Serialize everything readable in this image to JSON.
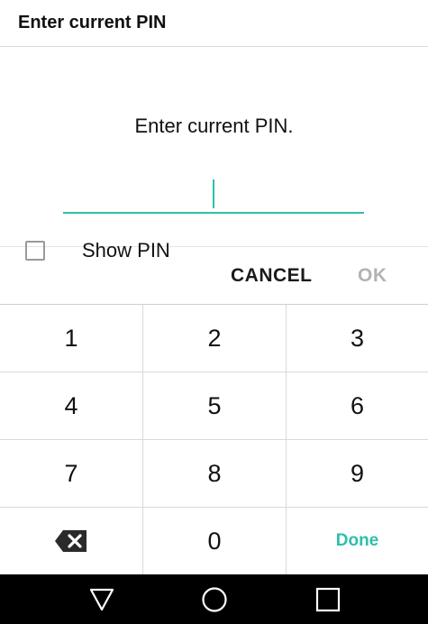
{
  "titlebar": {
    "title": "Enter current PIN"
  },
  "dialog": {
    "prompt": "Enter current PIN.",
    "pin_value": "",
    "show_pin_label": "Show PIN",
    "show_pin_checked": false
  },
  "actions": {
    "cancel_label": "CANCEL",
    "ok_label": "OK"
  },
  "keypad": {
    "keys": [
      "1",
      "2",
      "3",
      "4",
      "5",
      "6",
      "7",
      "8",
      "9",
      "backspace",
      "0",
      "Done"
    ],
    "backspace_icon": "backspace-icon",
    "done_label": "Done"
  },
  "navbar": {
    "icons": [
      "back-triangle-icon",
      "home-circle-icon",
      "recents-square-icon"
    ]
  },
  "colors": {
    "accent": "#2fbfaa",
    "disabled": "#b3b3b3",
    "navbar": "#000000"
  }
}
